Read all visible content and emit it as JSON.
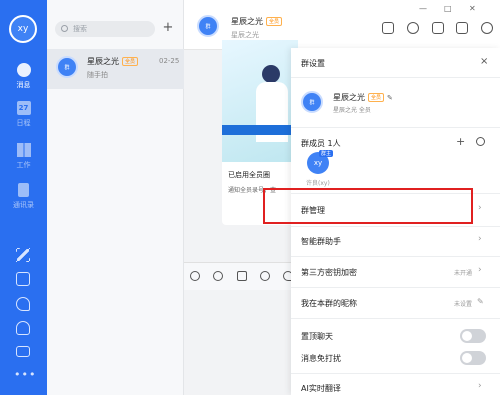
{
  "sidebar": {
    "avatar": "xy",
    "items": [
      {
        "label": "消息",
        "icon": "chat-bubble-icon"
      },
      {
        "label": "日程",
        "icon": "calendar-icon",
        "number": "27"
      },
      {
        "label": "工作",
        "icon": "grid-apps-icon"
      },
      {
        "label": "通讯录",
        "icon": "contacts-book-icon"
      }
    ],
    "bottom_icons": [
      "lightning-icon",
      "cube-icon",
      "phone-icon",
      "cloud-icon",
      "mail-icon",
      "more-icon"
    ]
  },
  "list": {
    "search_placeholder": "搜索",
    "add": "+",
    "conversations": [
      {
        "name": "星辰之光",
        "badge": "全员",
        "time": "02-25",
        "preview": "随手拍",
        "avatar": "群"
      }
    ]
  },
  "chat": {
    "title": "星辰之光",
    "badge": "全员",
    "subtitle": "星辰之光",
    "card": {
      "title": "已启用全员圈",
      "desc": "通知全员录号，查"
    },
    "header_icons": [
      "megaphone-icon",
      "clock-icon",
      "folder-icon",
      "calendar-video-icon",
      "plus-circle-icon"
    ],
    "toolbar_icons": [
      "gif-icon",
      "emoji-icon",
      "thumbs-up-icon",
      "scissors-icon",
      "phone-icon"
    ]
  },
  "window": {
    "minimize": "—",
    "maximize": "□",
    "close": "✕"
  },
  "panel": {
    "title": "群设置",
    "close": "×",
    "group_name": "星辰之光",
    "group_badge": "全员",
    "group_sub": "星辰之光 全员",
    "members_label": "群成员 1人",
    "member_avatar": "xy",
    "owner_tag": "群主",
    "member_name": "许良(xy)",
    "rows": [
      {
        "label": "群管理",
        "value": ""
      },
      {
        "label": "智能群助手",
        "value": ""
      },
      {
        "label": "第三方密钥加密",
        "value": "未开通"
      },
      {
        "label": "我在本群的昵称",
        "value": "未设置"
      },
      {
        "label": "置顶聊天",
        "toggle": "off"
      },
      {
        "label": "消息免打扰",
        "toggle": "off"
      },
      {
        "label": "AI实时翻译",
        "value": ""
      }
    ]
  }
}
